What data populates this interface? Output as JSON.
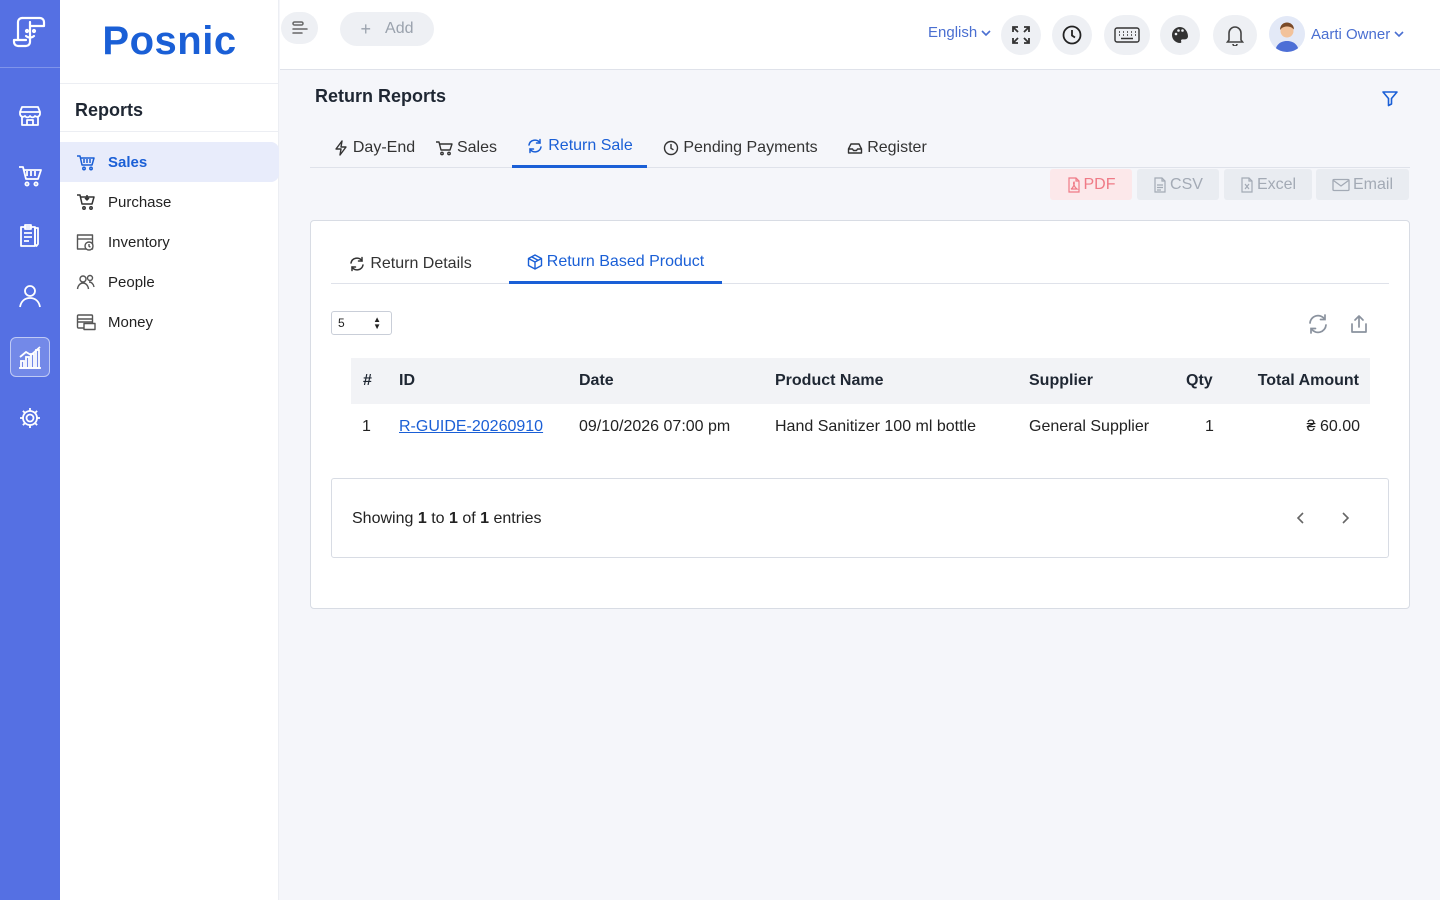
{
  "app": {
    "brand": "Posnic"
  },
  "sidebar": {
    "title": "Reports",
    "items": [
      {
        "label": "Sales",
        "icon": "basket-icon",
        "active": true
      },
      {
        "label": "Purchase",
        "icon": "cart-icon"
      },
      {
        "label": "Inventory",
        "icon": "box-icon"
      },
      {
        "label": "People",
        "icon": "people-icon"
      },
      {
        "label": "Money",
        "icon": "money-icon"
      }
    ]
  },
  "topbar": {
    "add_label": "Add",
    "language": "English",
    "user_name": "Aarti Owner"
  },
  "page": {
    "title": "Return Reports",
    "tabs": [
      {
        "label": "Day-End",
        "icon": "bolt-icon"
      },
      {
        "label": "Sales",
        "icon": "cart-icon"
      },
      {
        "label": "Return Sale",
        "icon": "return-icon",
        "active": true
      },
      {
        "label": "Pending Payments",
        "icon": "clock-icon"
      },
      {
        "label": "Register",
        "icon": "tray-icon"
      }
    ],
    "exports": {
      "pdf": "PDF",
      "csv": "CSV",
      "excel": "Excel",
      "email": "Email"
    }
  },
  "card": {
    "subtabs": [
      {
        "label": "Return Details",
        "icon": "refresh-icon"
      },
      {
        "label": "Return Based Product",
        "icon": "package-icon",
        "active": true
      }
    ],
    "page_size": "5",
    "table": {
      "columns": [
        "#",
        "ID",
        "Date",
        "Product Name",
        "Supplier",
        "Qty",
        "Total Amount"
      ],
      "rows": [
        {
          "num": "1",
          "id": "R-GUIDE-20260910",
          "date": "09/10/2026 07:00 pm",
          "product": "Hand Sanitizer 100 ml bottle",
          "supplier": "General Supplier",
          "qty": "1",
          "total": "₴ 60.00"
        }
      ]
    },
    "footer": {
      "prefix": "Showing",
      "from": "1",
      "to_word": "to",
      "to": "1",
      "of_word": "of",
      "total": "1",
      "suffix": "entries"
    }
  },
  "colors": {
    "rail": "#5570e3",
    "accent": "#1a5fd6",
    "pdf": "#ef7a86"
  }
}
